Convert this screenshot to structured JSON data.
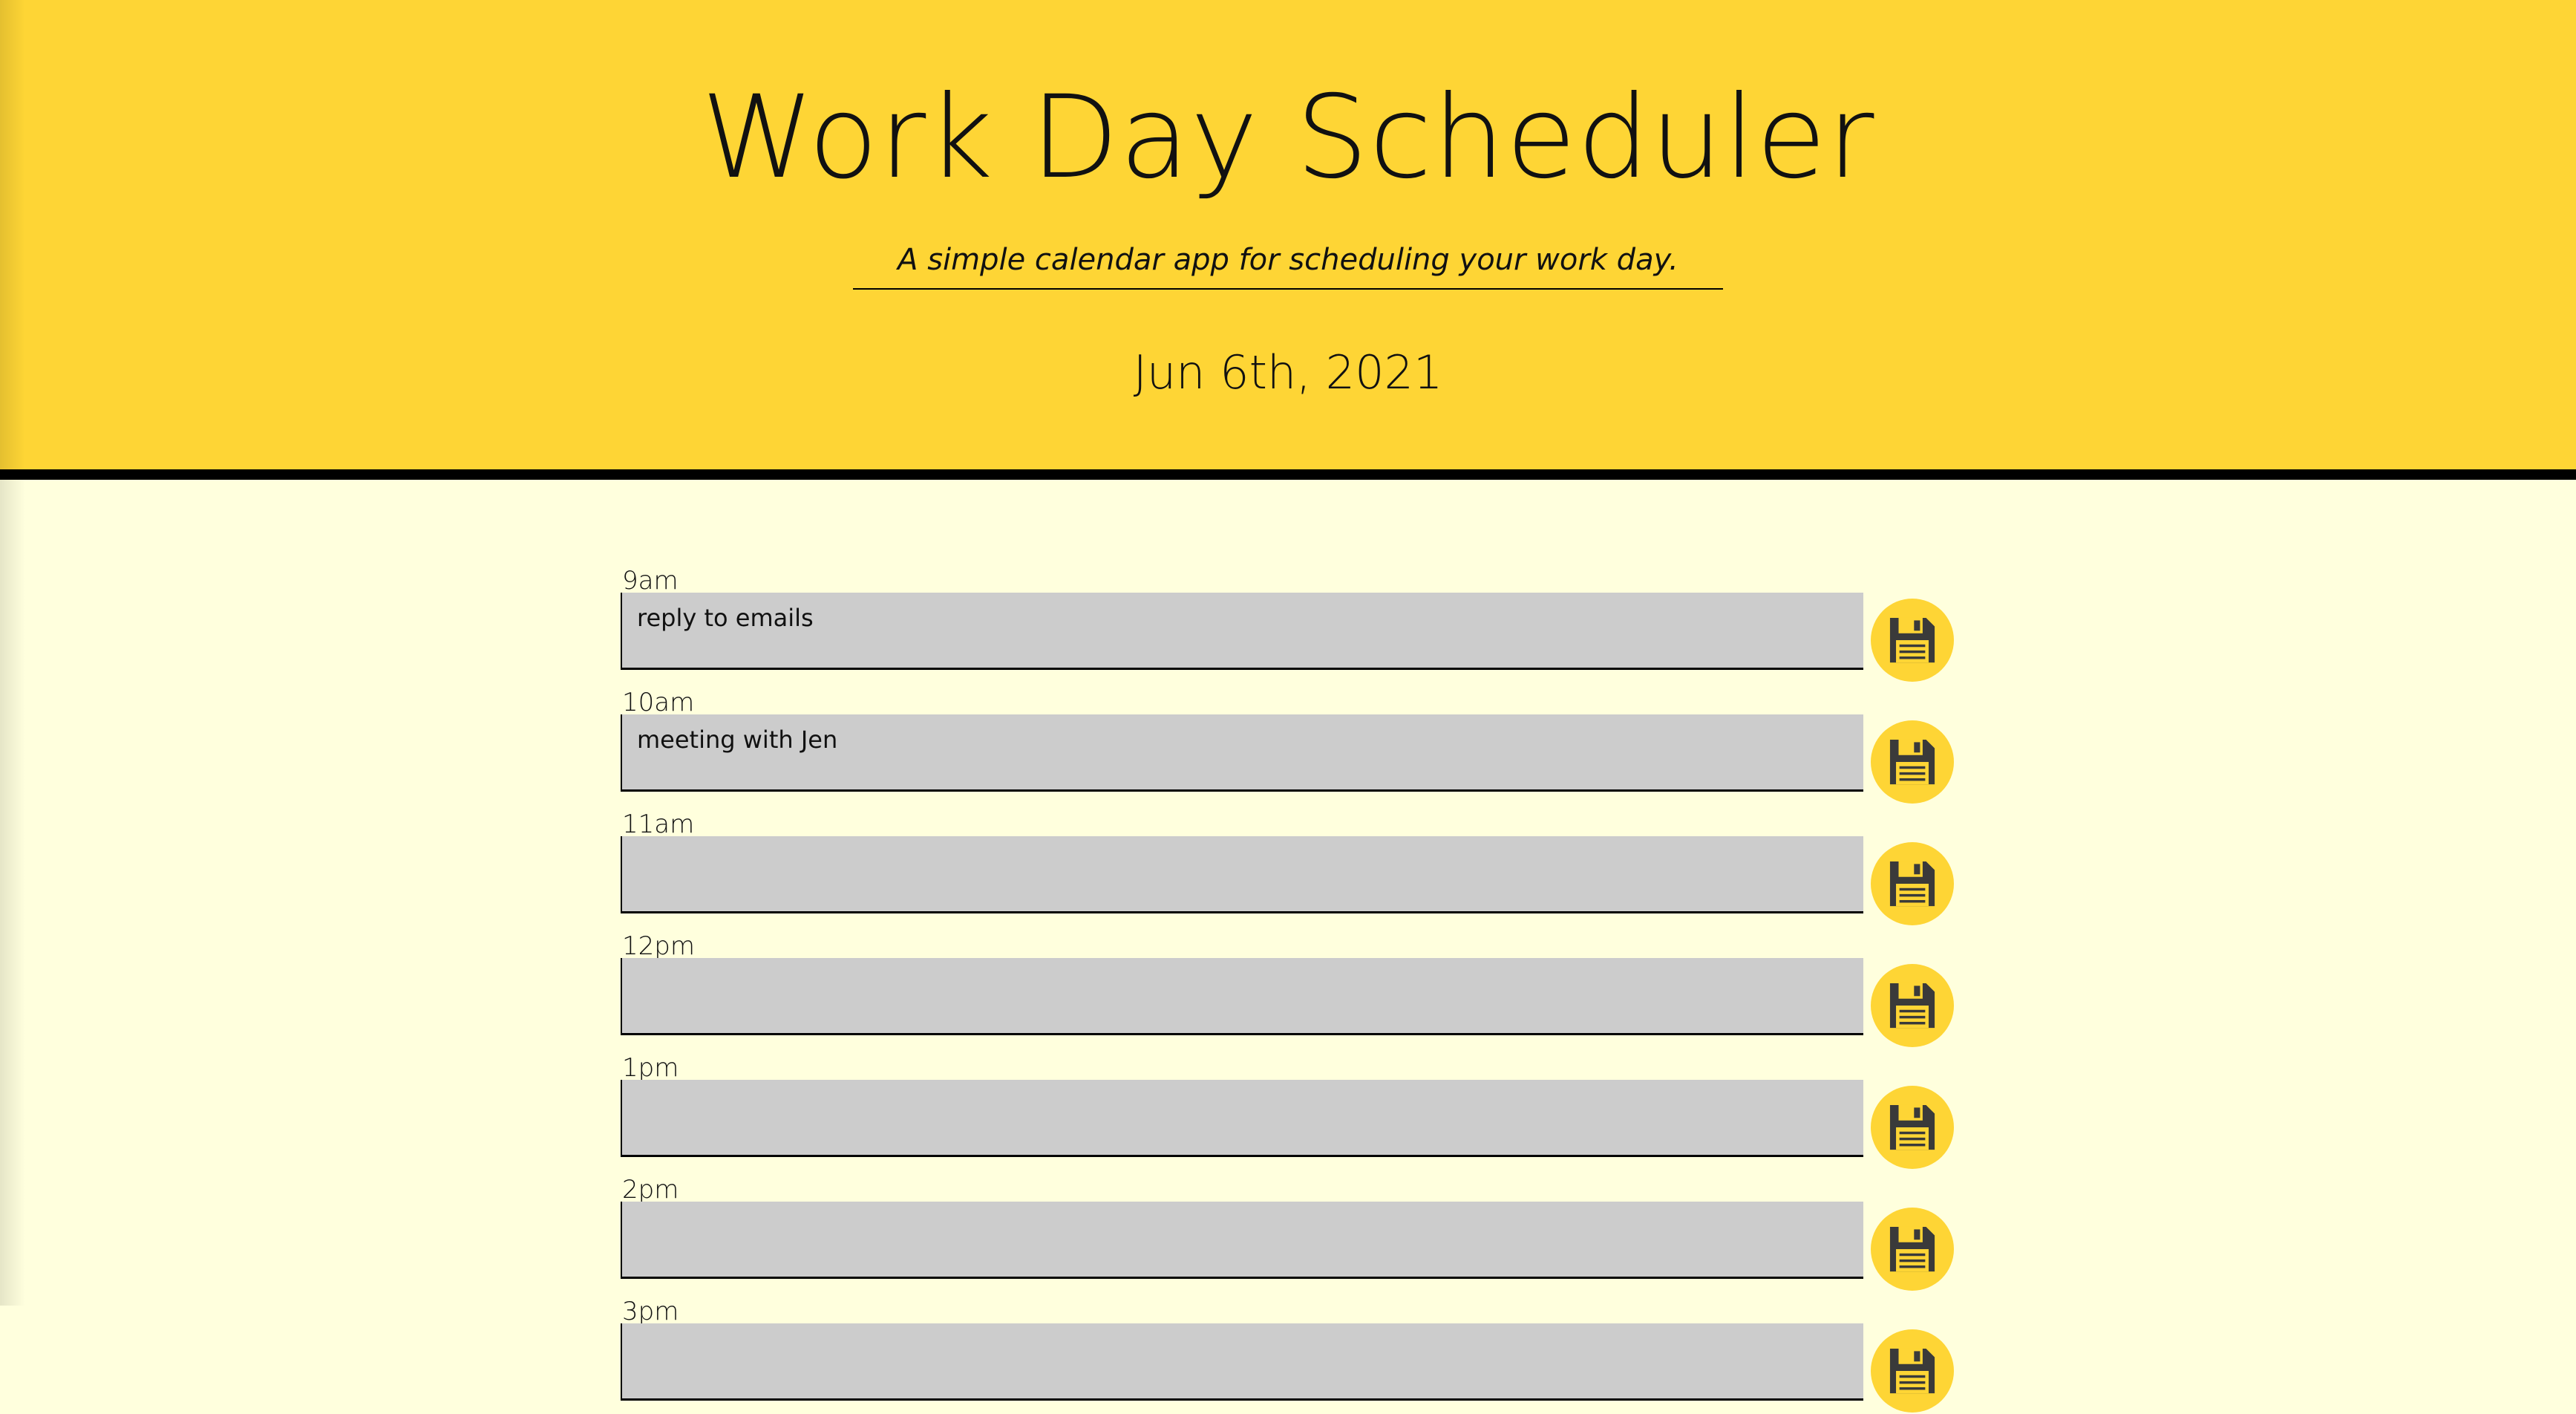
{
  "header": {
    "title": "Work Day Scheduler",
    "lead": "A simple calendar app for scheduling your work day.",
    "current_day": "Jun 6th, 2021"
  },
  "colors": {
    "header_bg": "#fed535",
    "page_bg": "#ffffdd",
    "block_past": "#cccccc",
    "save_button": "#fed535",
    "save_icon": "#3a3a3a"
  },
  "icons": {
    "save": "floppy-disk-icon"
  },
  "time_blocks": [
    {
      "hour": "9am",
      "text": ""
    },
    {
      "hour": "10am",
      "text": ""
    },
    {
      "hour": "11am",
      "text": ""
    },
    {
      "hour": "12pm",
      "text": ""
    },
    {
      "hour": "1pm",
      "text": ""
    },
    {
      "hour": "2pm",
      "text": ""
    },
    {
      "hour": "3pm",
      "text": ""
    }
  ],
  "time_block_notes": [
    "reply to emails",
    "meeting with Jen",
    "",
    "",
    "",
    "",
    ""
  ]
}
